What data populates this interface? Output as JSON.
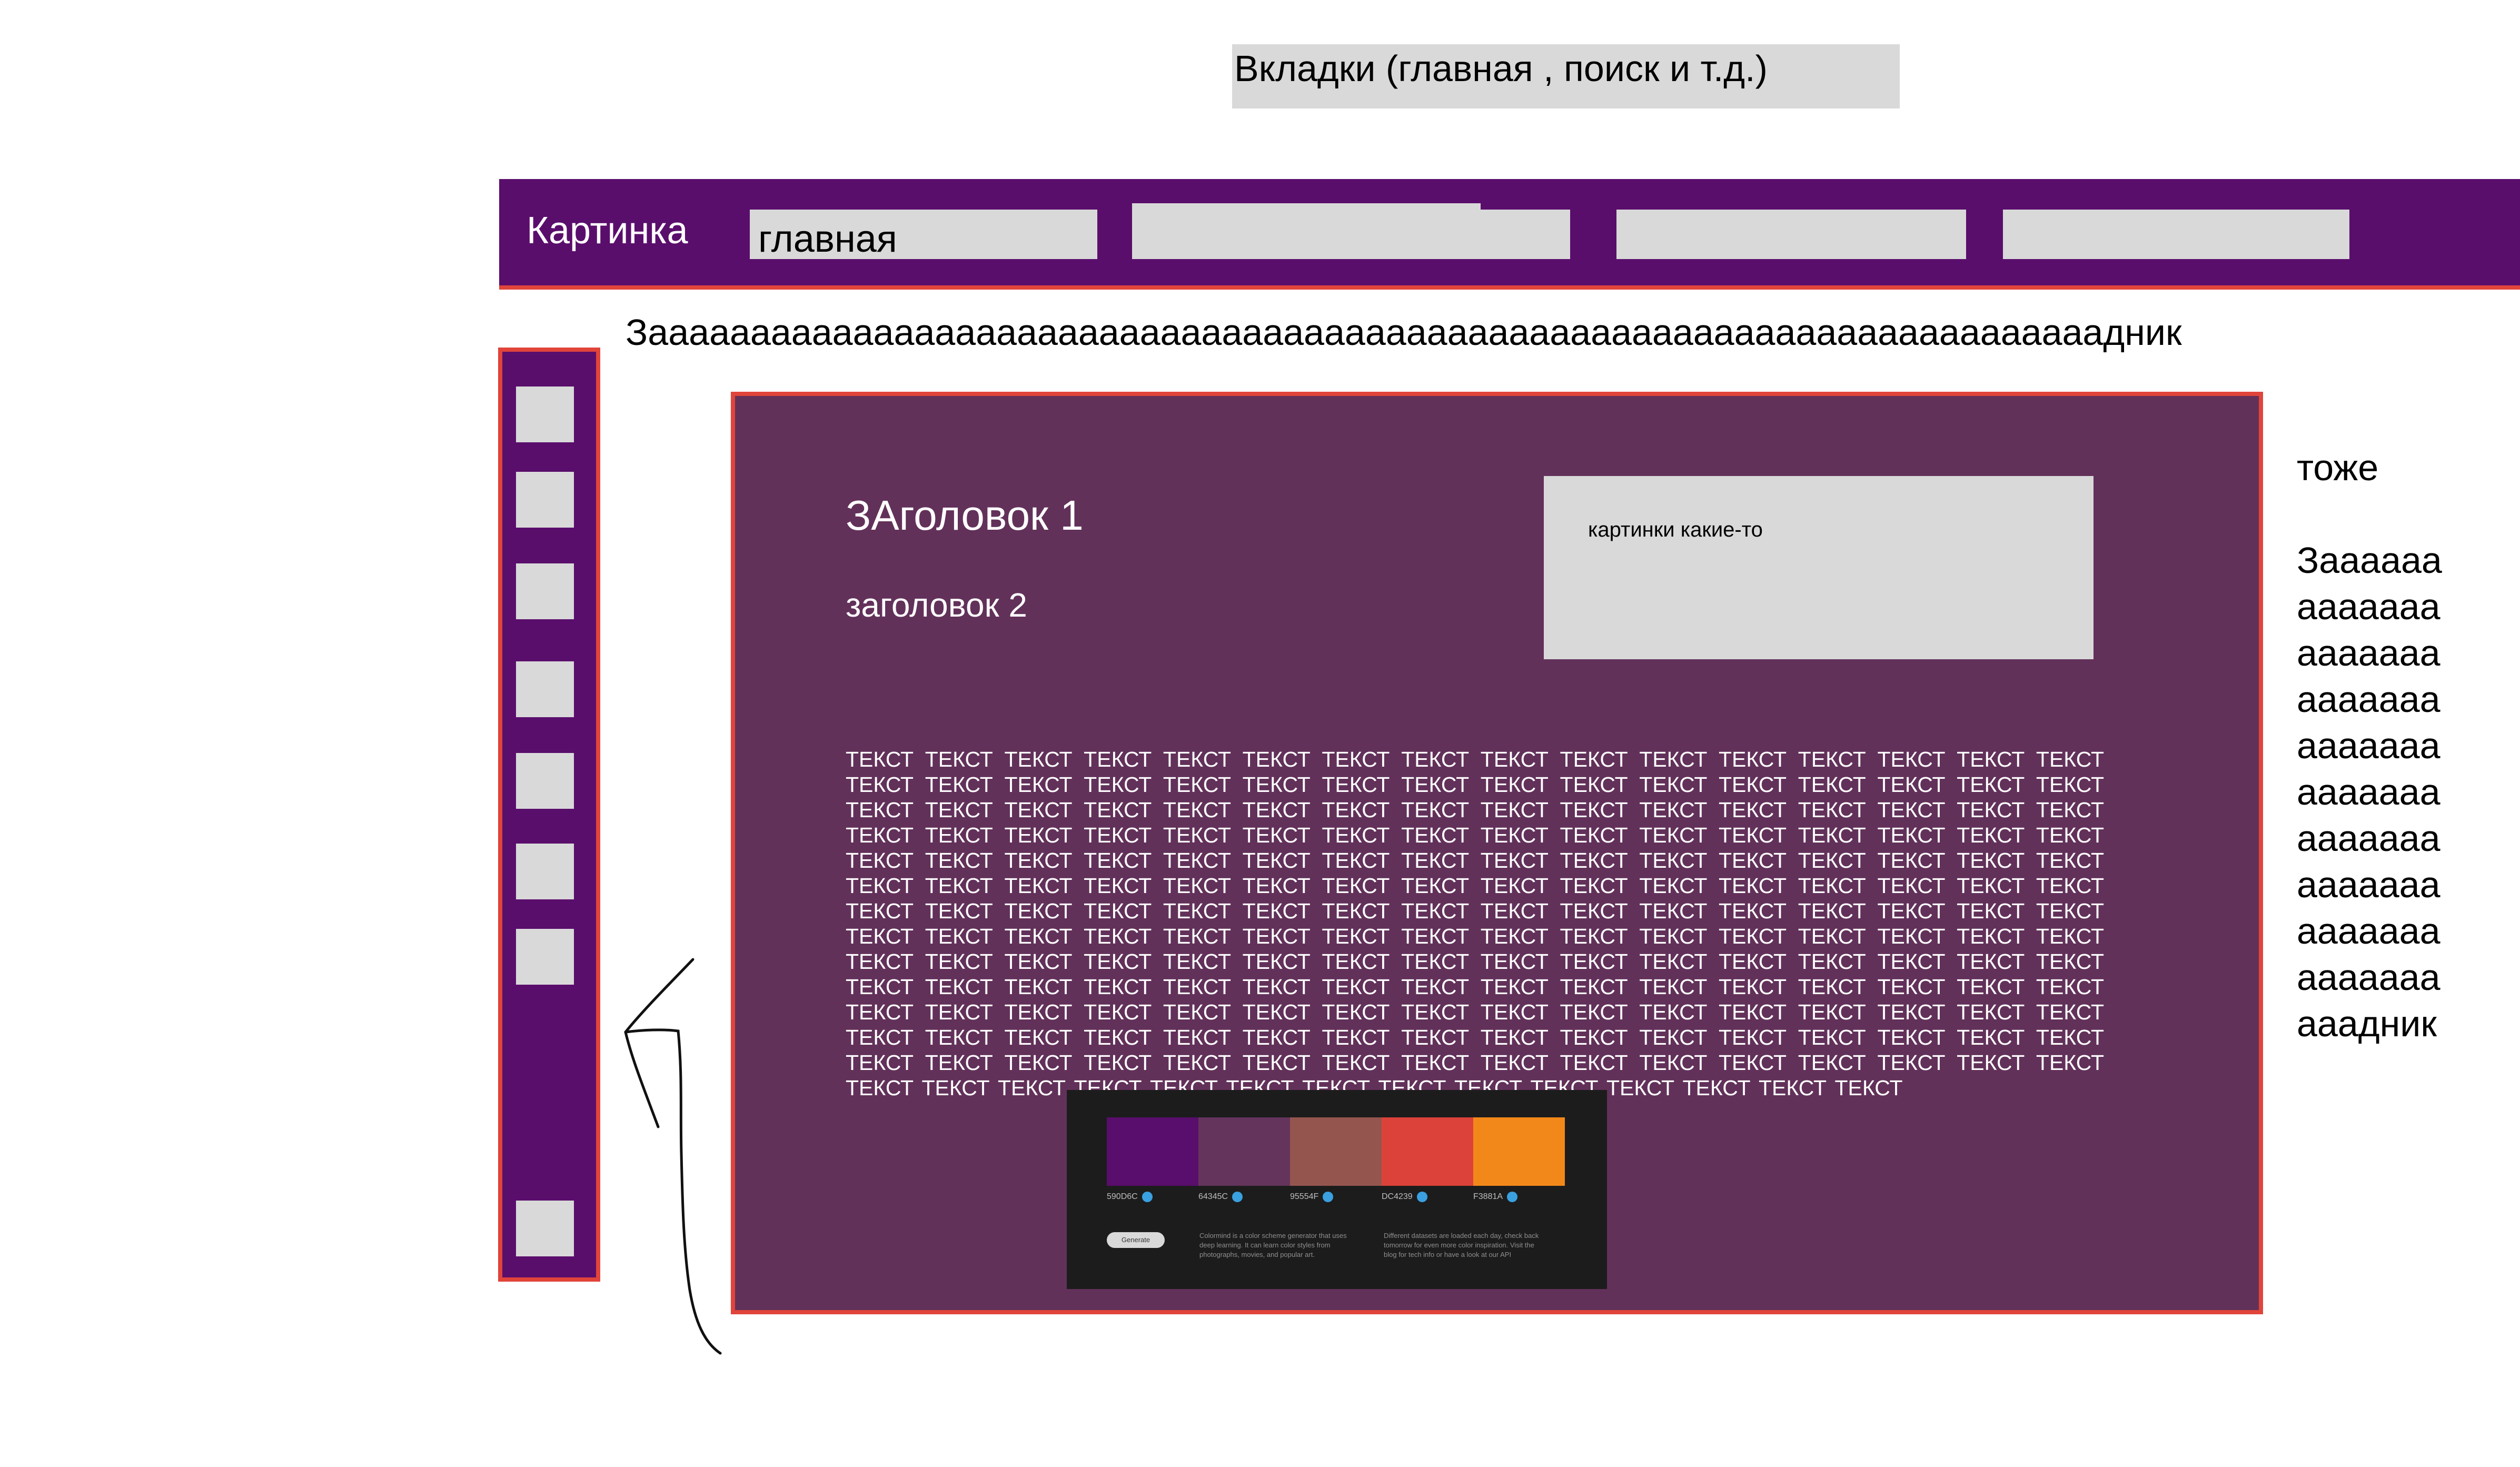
{
  "tabs_note": "Вкладки (главная , поиск и т.д.)",
  "navbar": {
    "logo_text": "Картинка",
    "tabs": [
      {
        "label": "главная"
      },
      {
        "label": ""
      },
      {
        "label": ""
      },
      {
        "label": ""
      }
    ]
  },
  "header_text": "Зааааааааааааааааааааааааааааааааааааааааааааааааааааааааааааааааааааааадник",
  "sidebar": {
    "button_count": 8
  },
  "main": {
    "heading_1": "ЗАголовок 1",
    "heading_2": "заголовок 2",
    "images_label": "картинки какие-то",
    "body_text": " ТЕКСТ ТЕКСТ ТЕКСТ ТЕКСТ ТЕКСТ ТЕКСТ ТЕКСТ ТЕКСТ ТЕКСТ ТЕКСТ ТЕКСТ ТЕКСТ ТЕКСТ ТЕКСТ ТЕКСТ ТЕКСТ ТЕКСТ ТЕКСТ ТЕКСТ ТЕКСТ  ТЕКСТ ТЕКСТ ТЕКСТ ТЕКСТ ТЕКСТ ТЕКСТ ТЕКСТ ТЕКСТ ТЕКСТ ТЕКСТ ТЕКСТ ТЕКСТ ТЕКСТ ТЕКСТ ТЕКСТ ТЕКСТ ТЕКСТ ТЕКСТ ТЕКСТ ТЕКСТ  ТЕКСТ ТЕКСТ ТЕКСТ ТЕКСТ ТЕКСТ ТЕКСТ ТЕКСТ ТЕКСТ ТЕКСТ ТЕКСТ ТЕКСТ ТЕКСТ ТЕКСТ ТЕКСТ ТЕКСТ ТЕКСТ ТЕКСТ ТЕКСТ ТЕКСТ  ТЕКСТ ТЕКСТ ТЕКСТ ТЕКСТ ТЕКСТ ТЕКСТ ТЕКСТ ТЕКСТ ТЕКСТ ТЕКСТ ТЕКСТ ТЕКСТ ТЕКСТ ТЕКСТ ТЕКСТ ТЕКСТ ТЕКСТ ТЕКСТ ТЕКСТ ТЕКСТ  ТЕКСТ ТЕКСТ ТЕКСТ ТЕКСТ ТЕКСТ ТЕКСТ ТЕКСТ ТЕКСТ ТЕКСТ ТЕКСТ ТЕКСТ ТЕКСТ ТЕКСТ ТЕКСТ ТЕКСТ ТЕКСТ ТЕКСТ ТЕКСТ ТЕКСТ ТЕКСТ  ТЕКСТ ТЕКСТ ТЕКСТ ТЕКСТ ТЕКСТ ТЕКСТ ТЕКСТ ТЕКСТ ТЕКСТ ТЕКСТ ТЕКСТ ТЕКСТ ТЕКСТ ТЕКСТ ТЕКСТ ТЕКСТ ТЕКСТ ТЕКСТ ТЕКСТ ТЕКСТ  ТЕКСТ ТЕКСТ ТЕКСТ ТЕКСТ ТЕКСТ ТЕКСТ ТЕКСТ ТЕКСТ ТЕКСТ ТЕКСТ ТЕКСТ ТЕКСТ ТЕКСТ ТЕКСТ ТЕКСТ ТЕКСТ ТЕКСТ ТЕКСТ ТЕКСТ ТЕКСТ  ТЕКСТ ТЕКСТ ТЕКСТ ТЕКСТ ТЕКСТ ТЕКСТ ТЕКСТ ТЕКСТ ТЕКСТ ТЕКСТ ТЕКСТ ТЕКСТ ТЕКСТ ТЕКСТ ТЕКСТ ТЕКСТ ТЕКСТ ТЕКСТ ТЕКСТ ТЕКСТ  ТЕКСТ ТЕКСТ ТЕКСТ ТЕКСТ ТЕКСТ ТЕКСТ ТЕКСТ ТЕКСТ ТЕКСТ ТЕКСТ ТЕКСТ ТЕКСТ ТЕКСТ ТЕКСТ ТЕКСТ ТЕКСТ ТЕКСТ ТЕКСТ ТЕКСТ ТЕКСТ  ТЕКСТ ТЕКСТ ТЕКСТ ТЕКСТ ТЕКСТ ТЕКСТ ТЕКСТ ТЕКСТ ТЕКСТ ТЕКСТ ТЕКСТ ТЕКСТ ТЕКСТ ТЕКСТ ТЕКСТ ТЕКСТ ТЕКСТ ТЕКСТ ТЕКСТ ТЕКСТ  ТЕКСТ ТЕКСТ ТЕКСТ ТЕКСТ ТЕКСТ ТЕКСТ ТЕКСТ ТЕКСТ ТЕКСТ ТЕКСТ ТЕКСТ ТЕКСТ ТЕКСТ ТЕКСТ ТЕКСТ ТЕКСТ ТЕКСТ ТЕКСТ ТЕКСТ ТЕКСТ  ТЕКСТ ТЕКСТ ТЕКСТ",
    "palette": {
      "colors": [
        {
          "hex": "590D6C",
          "color": "#590d6c"
        },
        {
          "hex": "64345C",
          "color": "#64345c"
        },
        {
          "hex": "95554F",
          "color": "#95554f"
        },
        {
          "hex": "DC4239",
          "color": "#dc4239"
        },
        {
          "hex": "F3881A",
          "color": "#f3881a"
        }
      ],
      "generate_label": "Generate",
      "text_1": "Colormind is a color scheme generator that uses deep learning. It can learn color styles from photographs, movies, and popular art.",
      "text_2": "Different datasets are loaded each day, check back tomorrow for even more color inspiration. Visit the blog for tech info or have a look at our API"
    }
  },
  "side_note": {
    "title": "тоже",
    "text": "Заааааааааааааааааааааааааааааааааааааааааааааааааааааааааааааааааааааааадник"
  },
  "colors": {
    "nav_purple": "#5a0e6c",
    "content_purple": "#62315a",
    "border_red": "#e0443a",
    "placeholder_gray": "#d9d9d9"
  }
}
